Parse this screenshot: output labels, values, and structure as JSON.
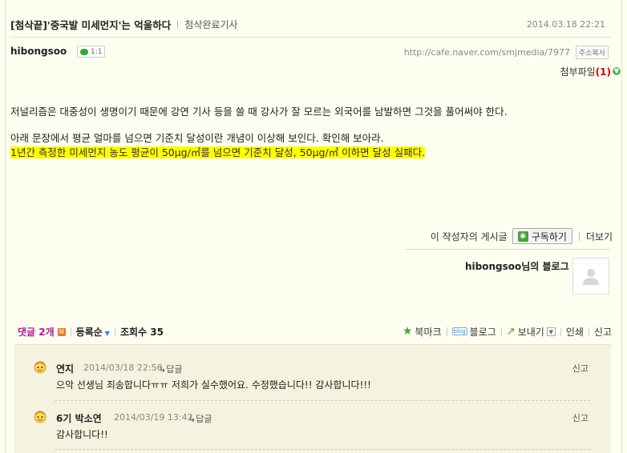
{
  "post": {
    "title": "[첨삭끝]'중국발 미세먼지'는 억울하다",
    "category": "첨삭완료기사",
    "date": "2014.03.18 22:21",
    "author": "hibongsoo",
    "chat_badge": "1:1",
    "url": "http://cafe.naver.com/smjmedia/7977",
    "copy_address_label": "주소복사",
    "attachment_label": "첨부파일",
    "attachment_count": "(1)",
    "body": {
      "line1": "저널리즘은 대중성이 생명이기 때문에 강연 기사 등을 쓸 때 강사가 잘 모르는 외국어를 남발하면 그것을 풀어써야 한다.",
      "line2": "아래 문장에서 평균 얼마를 넘으면 기준치 달성이란 개념이 이상해 보인다. 확인해 보아라.",
      "line3_highlight": "1년간 측정한 미세먼지 농도 평균이 50μg/㎥를 넘으면 기준치 달성, 50μg/㎥ 이하면 달성 실패다."
    }
  },
  "author_box": {
    "posts_label": "이 작성자의 게시글",
    "subscribe_label": "구독하기",
    "more_label": "더보기",
    "blog_link": "hibongsoo님의 블로그"
  },
  "comment_bar": {
    "comments_label": "댓글 2개",
    "new_icon": "N",
    "order_label": "등록순",
    "views_label": "조회수 35",
    "bookmark_label": "북마크",
    "blog_label": "블로그",
    "blog_mini": "blog",
    "send_label": "보내기",
    "print_label": "인쇄",
    "report_label": "신고"
  },
  "comments": [
    {
      "name": "연지",
      "date": "2014/03/18 22:56",
      "reply_label": "답글",
      "report_label": "신고",
      "text": "으악 선생님 죄송합니다ㅠㅠ 저희가 실수했어요. 수정했습니다!! 감사합니다!!!"
    },
    {
      "name": "6기 박소연",
      "date": "2014/03/19 13:42",
      "reply_label": "답글",
      "report_label": "신고",
      "text": "감사합니다!!"
    }
  ],
  "colors": {
    "background": "#fdfdf0",
    "highlight": "#ffff00",
    "comment_count": "#a81e9a",
    "green_accent": "#3aa838",
    "attach_count": "#d20000"
  }
}
